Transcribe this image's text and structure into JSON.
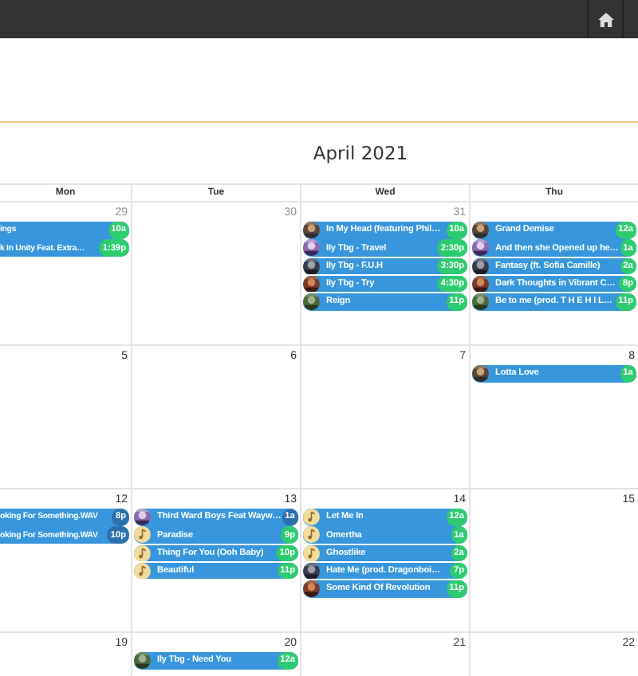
{
  "title": "April 2021",
  "weekdays": [
    "Mon",
    "Tue",
    "Wed",
    "Thu"
  ],
  "weeks": [
    {
      "days": [
        {
          "number": "29",
          "muted": true,
          "events": [
            {
              "title": "ings",
              "time": "10a",
              "color": "#2ecc71"
            },
            {
              "title": "k In Unity Feat. Extra…",
              "time": "1:39p",
              "color": "#2ecc71"
            }
          ]
        },
        {
          "number": "30",
          "muted": true
        },
        {
          "number": "31",
          "muted": true,
          "events": [
            {
              "title": "In My Head (featuring Phil…",
              "time": "10a",
              "color": "#2ecc71"
            },
            {
              "title": "Ily Tbg - Travel",
              "time": "2:30p",
              "color": "#2ecc71"
            },
            {
              "title": "Ily Tbg - F.U.H",
              "time": "3:30p",
              "color": "#2ecc71"
            },
            {
              "title": "Ily Tbg - Try",
              "time": "4:30p",
              "color": "#2ecc71"
            },
            {
              "title": "Reign",
              "time": "11p",
              "color": "#2ecc71"
            }
          ]
        },
        {
          "events": [
            {
              "title": "Grand Demise",
              "time": "12a",
              "color": "#2ecc71"
            },
            {
              "title": "And then she Opened up he…",
              "time": "1a",
              "color": "#2ecc71"
            },
            {
              "title": "Fantasy (ft. Sofia Camille)",
              "time": "2a",
              "color": "#2ecc71"
            },
            {
              "title": "Dark Thoughts in Vibrant C…",
              "time": "8p",
              "color": "#2ecc71"
            },
            {
              "title": "Be to me (prod. T H E H I L…",
              "time": "11p",
              "color": "#2ecc71"
            }
          ]
        }
      ]
    },
    {
      "days": [
        {
          "number": "5",
          "muted": false
        },
        {
          "number": "6",
          "muted": false
        },
        {
          "number": "7",
          "muted": false
        },
        {
          "number": "8",
          "muted": false,
          "events": [
            {
              "title": "Lotta Love",
              "time": "1a",
              "color": "#2ecc71"
            }
          ]
        }
      ]
    },
    {
      "days": [
        {
          "number": "12",
          "muted": false,
          "events": [
            {
              "title": "oking For Something.WAV",
              "time": "8p",
              "color": "#2c6fae"
            },
            {
              "title": "oking For Something.WAV",
              "time": "10p",
              "color": "#2c6fae"
            }
          ]
        },
        {
          "number": "13",
          "muted": false,
          "events": [
            {
              "title": "Third Ward Boys Feat Wayw…",
              "time": "1a",
              "color": "#2c6fae"
            },
            {
              "title": "Paradise",
              "time": "9p",
              "color": "#2ecc71",
              "kind": "note"
            },
            {
              "title": "Thing For You (Ooh Baby)",
              "time": "10p",
              "color": "#2ecc71",
              "kind": "note"
            },
            {
              "title": "Beautiful",
              "time": "11p",
              "color": "#2ecc71",
              "kind": "note"
            }
          ]
        },
        {
          "number": "14",
          "muted": false,
          "events": [
            {
              "title": "Let Me In",
              "time": "12a",
              "color": "#2ecc71",
              "kind": "note"
            },
            {
              "title": "Omertha",
              "time": "1a",
              "color": "#2ecc71",
              "kind": "note"
            },
            {
              "title": "Ghostlike",
              "time": "2a",
              "color": "#2ecc71",
              "kind": "note"
            },
            {
              "title": "Hate Me (prod. Dragonboi…",
              "time": "7p",
              "color": "#2ecc71"
            },
            {
              "title": "Some Kind Of Revolution",
              "time": "11p",
              "color": "#2ecc71"
            }
          ]
        },
        {
          "number": "15",
          "muted": false
        }
      ]
    },
    {
      "days": [
        {
          "number": "19",
          "muted": false
        },
        {
          "number": "20",
          "muted": false,
          "events": [
            {
              "title": "Ily Tbg - Need You",
              "time": "12a",
              "color": "#2ecc71"
            }
          ]
        },
        {
          "number": "21",
          "muted": false
        },
        {
          "number": "22",
          "muted": false
        }
      ]
    }
  ]
}
